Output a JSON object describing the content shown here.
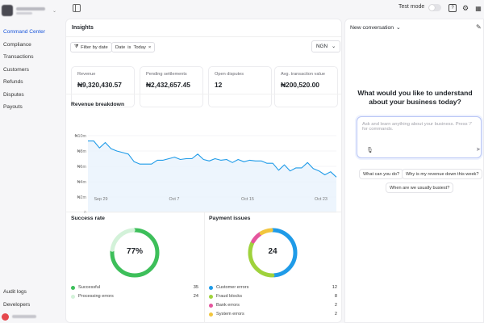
{
  "sidebar": {
    "items": [
      {
        "label": "Command Center",
        "active": true
      },
      {
        "label": "Compliance"
      },
      {
        "label": "Transactions"
      },
      {
        "label": "Customers"
      },
      {
        "label": "Refunds"
      },
      {
        "label": "Disputes"
      },
      {
        "label": "Payouts"
      }
    ],
    "bottom_items": [
      {
        "label": "Audit logs"
      },
      {
        "label": "Developers"
      }
    ]
  },
  "topbar": {
    "test_mode_label": "Test mode",
    "test_mode_on": false,
    "icons": [
      "sidebar-toggle-icon",
      "help-icon",
      "gear-icon",
      "grid-icon"
    ]
  },
  "insights": {
    "title": "Insights",
    "filter_by_date": "Filter by date",
    "date_filter": {
      "field": "Date",
      "op": "is",
      "value": "Today"
    },
    "currency": "NGN",
    "stats": [
      {
        "label": "Revenue",
        "value": "₦9,320,430.57"
      },
      {
        "label": "Pending settlements",
        "value": "₦2,432,657.45"
      },
      {
        "label": "Open disputes",
        "value": "12"
      },
      {
        "label": "Avg. transaction value",
        "value": "₦200,520.00"
      }
    ],
    "revenue_title": "Revenue breakdown",
    "success_title": "Success rate",
    "success_center": "77%",
    "success_legend": [
      {
        "label": "Successful",
        "count": "35",
        "color": "#3dbf5a"
      },
      {
        "label": "Processing errors",
        "count": "24",
        "color": "#d3f2d9"
      }
    ],
    "issues_title": "Payment issues",
    "issues_center": "24",
    "issues_legend": [
      {
        "label": "Customer errors",
        "count": "12",
        "color": "#1f9be8"
      },
      {
        "label": "Fraud blocks",
        "count": "8",
        "color": "#9fd23c"
      },
      {
        "label": "Bank errors",
        "count": "2",
        "color": "#e5569e"
      },
      {
        "label": "System errors",
        "count": "2",
        "color": "#f2c53d"
      }
    ]
  },
  "conversation": {
    "title": "New conversation",
    "heading_line1": "What would you like to understand",
    "heading_line2": "about your business today?",
    "placeholder": "Ask and learn anything about your business. Press '/' for commands.",
    "suggestions": [
      "What can you do?",
      "Why is my revenue down this week?",
      "When are we usually busiest?"
    ]
  },
  "chart_data": [
    {
      "type": "line",
      "title": "Revenue breakdown",
      "y_ticks": [
        "0",
        "₦2m",
        "₦4m",
        "₦6m",
        "₦8m",
        "₦10m"
      ],
      "ylim": [
        0,
        10000000
      ],
      "x_ticks": [
        "Sep 29",
        "Oct 7",
        "Oct 15",
        "Oct 23"
      ],
      "grid": true,
      "line_color": "#1f9be8",
      "values": [
        9.3,
        9.3,
        8.4,
        9.1,
        8.3,
        8.0,
        7.8,
        7.6,
        6.6,
        6.3,
        6.3,
        6.3,
        6.8,
        6.8,
        7.0,
        7.2,
        6.9,
        7.0,
        7.0,
        7.6,
        6.9,
        6.7,
        7.0,
        6.8,
        6.9,
        6.5,
        6.9,
        6.6,
        6.8,
        6.7,
        6.7,
        6.4,
        6.4,
        5.5,
        6.2,
        5.4,
        5.8,
        5.8,
        6.5,
        5.7,
        5.4,
        4.9,
        5.3,
        4.6
      ]
    },
    {
      "type": "pie",
      "title": "Success rate",
      "center_label": "77%",
      "categories": [
        "Successful",
        "Processing errors"
      ],
      "values": [
        35,
        24
      ],
      "shown_fraction": 0.77,
      "colors": [
        "#3dbf5a",
        "#d3f2d9"
      ]
    },
    {
      "type": "pie",
      "title": "Payment issues",
      "center_label": "24",
      "categories": [
        "Customer errors",
        "Fraud blocks",
        "Bank errors",
        "System errors"
      ],
      "values": [
        12,
        8,
        2,
        2
      ],
      "colors": [
        "#1f9be8",
        "#9fd23c",
        "#e5569e",
        "#f2c53d"
      ]
    }
  ]
}
